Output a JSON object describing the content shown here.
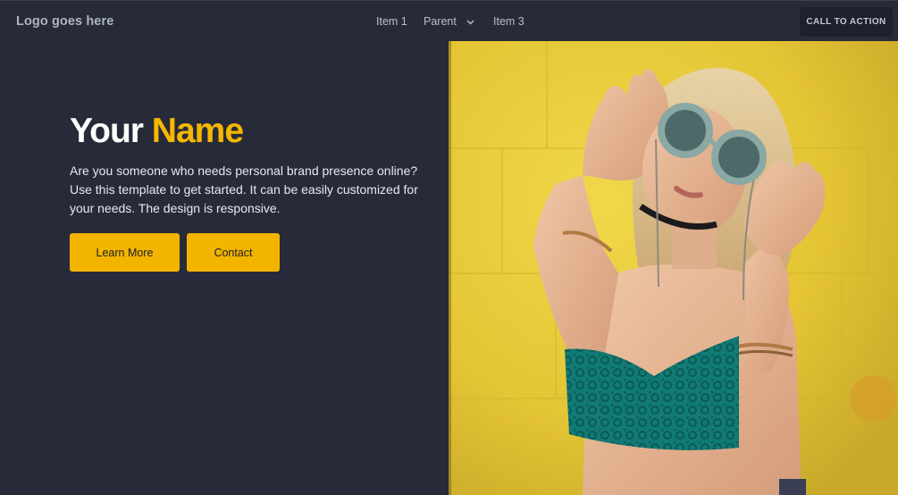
{
  "navbar": {
    "logo": "Logo goes here",
    "items": [
      {
        "label": "Item 1"
      },
      {
        "label": "Parent",
        "icon": "chevron-down-icon"
      },
      {
        "label": "Item 3"
      }
    ],
    "cta_label": "CALL TO ACTION"
  },
  "hero": {
    "title_first": "Your",
    "title_accent": "Name",
    "description": "Are you someone who needs personal brand presence online? Use this template to get started. It can be easily customized for your needs. The design is responsive.",
    "learn_more_label": "Learn More",
    "contact_label": "Contact",
    "image_alt": "Woman in sunglasses against yellow wall"
  },
  "colors": {
    "background": "#272b39",
    "accent": "#f3b400",
    "cta_background": "#1d212c"
  }
}
